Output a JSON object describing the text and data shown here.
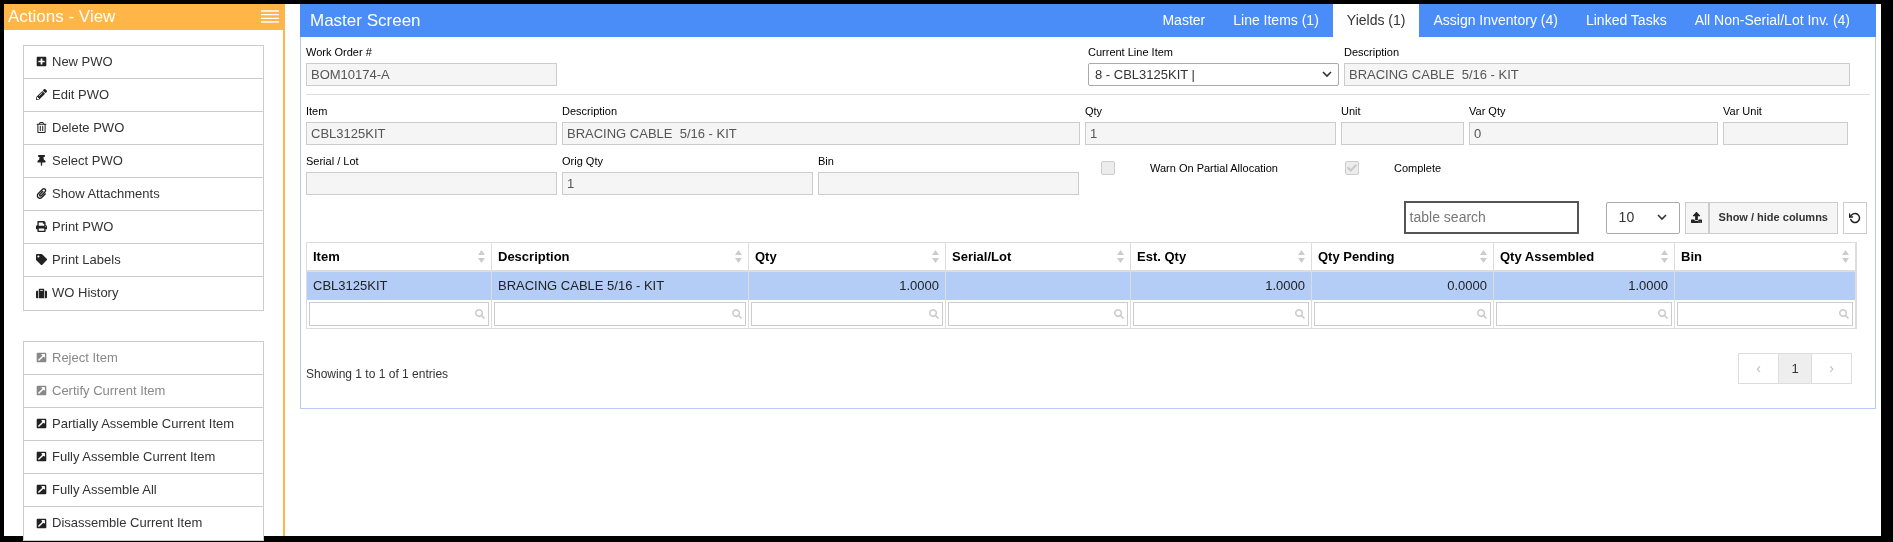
{
  "sidebar": {
    "title": "Actions - View",
    "actions": [
      {
        "label": "New PWO",
        "disabled": false
      },
      {
        "label": "Edit PWO",
        "disabled": false
      },
      {
        "label": "Delete PWO",
        "disabled": false
      },
      {
        "label": "Select PWO",
        "disabled": false
      },
      {
        "label": "Show Attachments",
        "disabled": false
      },
      {
        "label": "Print PWO",
        "disabled": false
      },
      {
        "label": "Print Labels",
        "disabled": false
      },
      {
        "label": "WO History",
        "disabled": false
      }
    ],
    "item_actions": [
      {
        "label": "Reject Item",
        "disabled": true
      },
      {
        "label": "Certify Current Item",
        "disabled": true
      },
      {
        "label": "Partially Assemble Current Item",
        "disabled": false
      },
      {
        "label": "Fully Assemble Current Item",
        "disabled": false
      },
      {
        "label": "Fully Assemble All",
        "disabled": false
      },
      {
        "label": "Disassemble Current Item",
        "disabled": false
      }
    ]
  },
  "header": {
    "title": "Master Screen",
    "tabs": [
      {
        "label": "Master",
        "selected": false
      },
      {
        "label": "Line Items (1)",
        "selected": false
      },
      {
        "label": "Yields (1)",
        "selected": true
      },
      {
        "label": "Assign Inventory (4)",
        "selected": false
      },
      {
        "label": "Linked Tasks",
        "selected": false
      },
      {
        "label": "All Non-Serial/Lot Inv. (4)",
        "selected": false
      }
    ]
  },
  "work_order": {
    "label": "Work Order #",
    "value": "BOM10174-A"
  },
  "current_line_item": {
    "label": "Current Line Item",
    "value": "8 - CBL3125KIT |"
  },
  "line_description": {
    "label": "Description",
    "value": "BRACING CABLE  5/16 - KIT"
  },
  "fields_row_1": [
    {
      "label": "Item",
      "value": "CBL3125KIT"
    },
    {
      "label": "Description",
      "value": "BRACING CABLE  5/16 - KIT"
    },
    {
      "label": "Qty",
      "value": "1"
    },
    {
      "label": "Unit"
    },
    {
      "label": "Var Qty",
      "value": "0"
    },
    {
      "label": "Var Unit"
    }
  ],
  "fields_row_2": [
    {
      "label": "Serial / Lot"
    },
    {
      "label": "Orig Qty",
      "value": "1"
    },
    {
      "label": "Bin"
    }
  ],
  "checkboxes": [
    {
      "label": "Warn On Partial Allocation",
      "checked": false
    },
    {
      "label": "Complete",
      "checked": true
    }
  ],
  "toolbar": {
    "search_placeholder": "table search",
    "page_size": "10",
    "columns_button": "Show / hide columns"
  },
  "table": {
    "columns": [
      "Item",
      "Description",
      "Qty",
      "Serial/Lot",
      "Est. Qty",
      "Qty Pending",
      "Qty Assembled",
      "Bin"
    ],
    "rows": [
      {
        "selected": true,
        "cells": [
          "CBL3125KIT",
          "BRACING CABLE 5/16 - KIT",
          "1.0000",
          "",
          "1.0000",
          "0.0000",
          "1.0000",
          ""
        ]
      }
    ]
  },
  "footer": {
    "info": "Showing 1 to 1 of 1 entries",
    "prev": "‹",
    "page": "1",
    "next": "›"
  }
}
